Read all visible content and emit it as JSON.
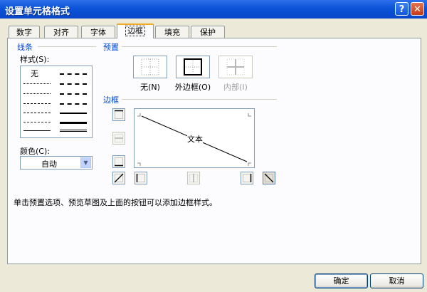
{
  "window": {
    "title": "设置单元格格式"
  },
  "tabs": [
    {
      "label": "数字"
    },
    {
      "label": "对齐"
    },
    {
      "label": "字体"
    },
    {
      "label": "边框",
      "active": true
    },
    {
      "label": "填充"
    },
    {
      "label": "保护"
    }
  ],
  "line": {
    "group_label": "线条",
    "style_label": "样式(S):",
    "none_label": "无",
    "color_label": "颜色(C):",
    "color_value": "自动"
  },
  "presets": {
    "group_label": "预置",
    "none": "无(N)",
    "outline": "外边框(O)",
    "inside": "内部(I)"
  },
  "border": {
    "group_label": "边框",
    "preview_text": "文本"
  },
  "hint": "单击预置选项、预览草图及上面的按钮可以添加边框样式。",
  "buttons": {
    "ok": "确定",
    "cancel": "取消"
  },
  "colors": {
    "title_bar": "#0A53D8",
    "group_label": "#0046D5",
    "active_tab_accent": "#F5A623",
    "disabled_text": "#A0A0A0"
  }
}
